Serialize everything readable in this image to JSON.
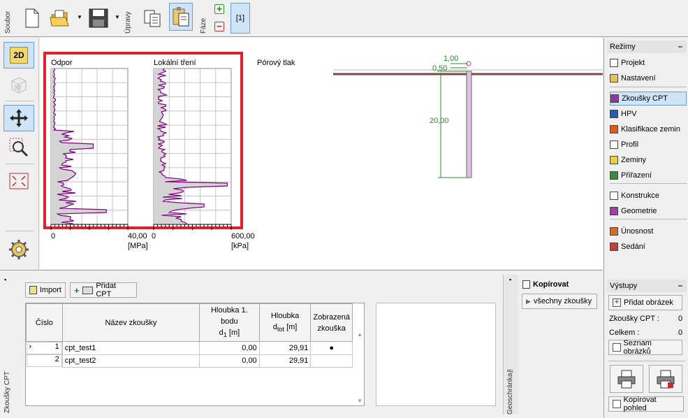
{
  "toolbar": {
    "soubor_label": "Soubor",
    "upravy_label": "Úpravy",
    "faze_label": "Fáze",
    "stage_label": "[1]"
  },
  "left_tools": {
    "mode_2d": "2D",
    "mode_3d": "3D"
  },
  "chart": {
    "panel1_title": "Odpor",
    "panel2_title": "Lokální tření",
    "panel3_title": "Pórový tlak",
    "panel1_xmin": "0",
    "panel1_xmax": "40,00",
    "panel1_unit": "[MPa]",
    "panel2_xmin": "0",
    "panel2_xmax": "600,00",
    "panel2_unit": "[kPa]",
    "highlight_color": "#e0202a",
    "profile_color": "#800080"
  },
  "profile_view": {
    "dim_top1": "1,00",
    "dim_top2": "0,50",
    "dim_depth": "20,00"
  },
  "right_panel": {
    "rezimy_title": "Režimy",
    "items": [
      {
        "label": "Projekt",
        "icon": "document-icon"
      },
      {
        "label": "Nastavení",
        "icon": "gear-icon"
      },
      {
        "label": "Zkoušky CPT",
        "icon": "cpt-icon"
      },
      {
        "label": "HPV",
        "icon": "water-level-icon"
      },
      {
        "label": "Klasifikace zemin",
        "icon": "soil-classification-icon"
      },
      {
        "label": "Profil",
        "icon": "profile-icon"
      },
      {
        "label": "Zeminy",
        "icon": "soils-icon"
      },
      {
        "label": "Přiřazení",
        "icon": "assign-icon"
      },
      {
        "label": "Konstrukce",
        "icon": "construction-icon"
      },
      {
        "label": "Geometrie",
        "icon": "geometry-icon"
      },
      {
        "label": "Únosnost",
        "icon": "bearing-capacity-icon"
      },
      {
        "label": "Sedání",
        "icon": "settlement-icon"
      }
    ],
    "vystupy_title": "Výstupy",
    "add_image_label": "Přidat obrázek",
    "stat1_label": "Zkoušky CPT :",
    "stat1_value": "0",
    "stat2_label": "Celkem :",
    "stat2_value": "0",
    "image_list_label": "Seznam obrázků",
    "copy_view_label": "Kopírovat pohled"
  },
  "bottom": {
    "side_label": "Zkoušky CPT",
    "import_label": "Import",
    "add_cpt_label": "Přidat CPT",
    "headers": {
      "cislo": "Číslo",
      "nazev": "Název zkoušky",
      "hloubka1_line1": "Hloubka 1. bodu",
      "hloubka1_line2": "d",
      "hloubka1_sub": "1",
      "hloubka1_unit": "[m]",
      "hloubka_line1": "Hloubka",
      "hloubka_line2": "d",
      "hloubka_sub": "tot",
      "hloubka_unit": "[m]",
      "zobrazena_line1": "Zobrazená",
      "zobrazena_line2": "zkouška"
    },
    "rows": [
      {
        "cislo": "1",
        "nazev": "cpt_test1",
        "d1": "0,00",
        "dtot": "29,91",
        "shown": "●",
        "marker": "›"
      },
      {
        "cislo": "2",
        "nazev": "cpt_test2",
        "d1": "0,00",
        "dtot": "29,91",
        "shown": "",
        "marker": ""
      }
    ],
    "geoschranka_label": "Geoschránka™",
    "copy_title": "Kopírovat",
    "copy_all_label": "všechny zkoušky"
  }
}
